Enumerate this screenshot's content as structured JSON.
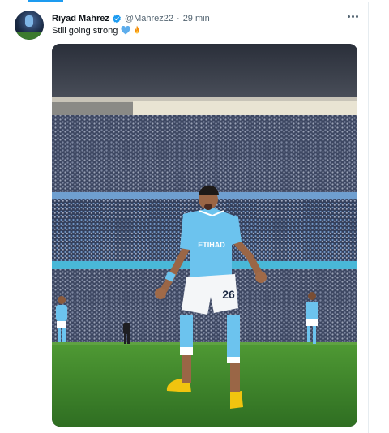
{
  "tweet": {
    "author_name": "Riyad Mahrez",
    "handle": "@Mahrez22",
    "separator": "·",
    "time": "29 min",
    "text": "Still going strong",
    "emojis": [
      "blue-heart",
      "fire"
    ],
    "verified": true
  },
  "player": {
    "sponsor": "ETIHAD",
    "number": "26"
  },
  "colors": {
    "verified": "#1d9bf0",
    "sky_blue": "#6cc3ee",
    "pitch": "#3f8a2c"
  }
}
